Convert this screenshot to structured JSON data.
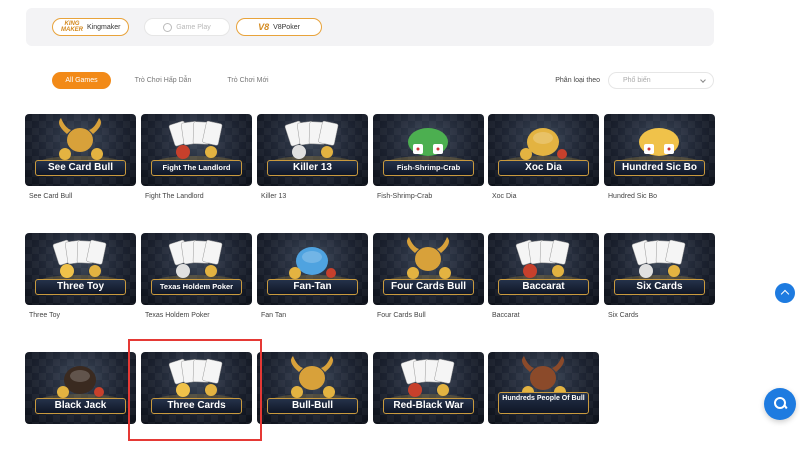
{
  "providers": [
    {
      "logo": "KING MAKER",
      "label": "Kingmaker",
      "state": "active"
    },
    {
      "logo": "",
      "label": "Game Play",
      "state": "inactive"
    },
    {
      "logo": "V8",
      "label": "V8Poker",
      "state": "active"
    }
  ],
  "filters": {
    "tabs": [
      "All Games",
      "Trò Chơi Hấp Dẫn",
      "Trò Chơi Mới"
    ],
    "active_tab": "All Games",
    "sort_label": "Phân loại theo",
    "sort_value": "Phổ biến"
  },
  "games": [
    {
      "banner": "See Card Bull",
      "name": "See Card Bull",
      "theme": "bull",
      "color": "#d8a13a"
    },
    {
      "banner": "Fight The Landlord",
      "name": "Fight The Landlord",
      "theme": "cards",
      "color": "#c7402c"
    },
    {
      "banner": "Killer 13",
      "name": "Killer 13",
      "theme": "cards",
      "color": "#e0e0e0"
    },
    {
      "banner": "Fish-Shrimp-Crab",
      "name": "Fish-Shrimp-Crab",
      "theme": "dice",
      "color": "#4caf50"
    },
    {
      "banner": "Xoc Dia",
      "name": "Xoc Dia",
      "theme": "coin",
      "color": "#e3b341"
    },
    {
      "banner": "Hundred Sic Bo",
      "name": "Hundred Sic Bo",
      "theme": "dice",
      "color": "#f0c24a"
    },
    {
      "banner": "Three Toy",
      "name": "Three Toy",
      "theme": "cards",
      "color": "#f0c24a"
    },
    {
      "banner": "Texas Holdem Poker",
      "name": "Texas Holdem Poker",
      "theme": "cards",
      "color": "#e0e0e0"
    },
    {
      "banner": "Fan-Tan",
      "name": "Fan Tan",
      "theme": "coin",
      "color": "#4fa3e0"
    },
    {
      "banner": "Four Cards Bull",
      "name": "Four Cards Bull",
      "theme": "bull",
      "color": "#d8a13a"
    },
    {
      "banner": "Baccarat",
      "name": "Baccarat",
      "theme": "cards",
      "color": "#c7402c"
    },
    {
      "banner": "Six Cards",
      "name": "Six Cards",
      "theme": "cards",
      "color": "#e0e0e0"
    },
    {
      "banner": "Black Jack",
      "name": "",
      "theme": "coin",
      "color": "#3a2a20"
    },
    {
      "banner": "Three Cards",
      "name": "",
      "theme": "cards",
      "color": "#f0c24a"
    },
    {
      "banner": "Bull-Bull",
      "name": "",
      "theme": "bull",
      "color": "#d8a13a"
    },
    {
      "banner": "Red-Black War",
      "name": "",
      "theme": "cards",
      "color": "#c7402c"
    },
    {
      "banner": "Hundreds People Of Bull",
      "name": "",
      "theme": "bull",
      "color": "#8b4a2a"
    }
  ]
}
